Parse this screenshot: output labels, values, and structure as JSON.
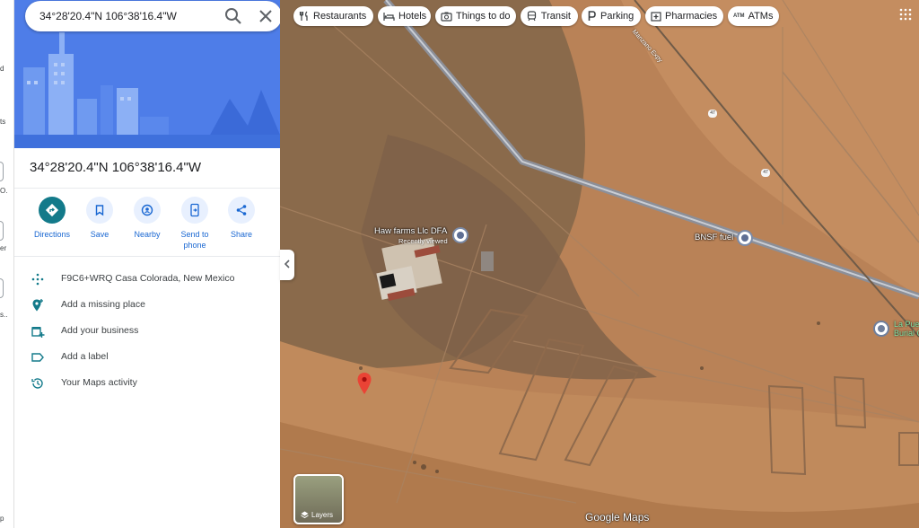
{
  "rail": {
    "fragments": [
      "d",
      "ts",
      "O.",
      "er",
      "s..",
      "p"
    ]
  },
  "search": {
    "value": "34°28'20.4\"N 106°38'16.4\"W",
    "search_icon": "search-icon",
    "close_icon": "close-icon"
  },
  "place": {
    "title": "34°28'20.4\"N 106°38'16.4\"W"
  },
  "actions": [
    {
      "label": "Directions",
      "icon": "directions-icon"
    },
    {
      "label": "Save",
      "icon": "bookmark-icon"
    },
    {
      "label": "Nearby",
      "icon": "nearby-icon"
    },
    {
      "label": "Send to phone",
      "icon": "send-to-phone-icon"
    },
    {
      "label": "Share",
      "icon": "share-icon"
    }
  ],
  "info": [
    {
      "text": "F9C6+WRQ Casa Colorada, New Mexico",
      "icon": "plus-code-icon"
    },
    {
      "text": "Add a missing place",
      "icon": "add-place-icon"
    },
    {
      "text": "Add your business",
      "icon": "business-icon"
    },
    {
      "text": "Add a label",
      "icon": "label-icon"
    },
    {
      "text": "Your Maps activity",
      "icon": "history-icon"
    }
  ],
  "chips": [
    {
      "label": "Restaurants",
      "icon": "restaurant-icon"
    },
    {
      "label": "Hotels",
      "icon": "hotel-icon"
    },
    {
      "label": "Things to do",
      "icon": "camera-icon"
    },
    {
      "label": "Transit",
      "icon": "transit-icon"
    },
    {
      "label": "Parking",
      "icon": "parking-icon"
    },
    {
      "label": "Pharmacies",
      "icon": "pharmacy-icon"
    },
    {
      "label": "ATMs",
      "icon": "atm-icon"
    }
  ],
  "map": {
    "places": [
      {
        "name": "Haw farms Llc DFA",
        "sub": "Recently viewed"
      },
      {
        "name": "BNSF fuel"
      }
    ],
    "green_place": "La Pue\nBurial C",
    "road_name": "Manzano Expy",
    "road_shield": "47",
    "layers_label": "Layers",
    "logo": "Google Maps"
  },
  "colors": {
    "accent": "#1a73e8",
    "hero": "#4e7de8",
    "pin": "#ea4335",
    "primary_action": "#137a8a"
  }
}
